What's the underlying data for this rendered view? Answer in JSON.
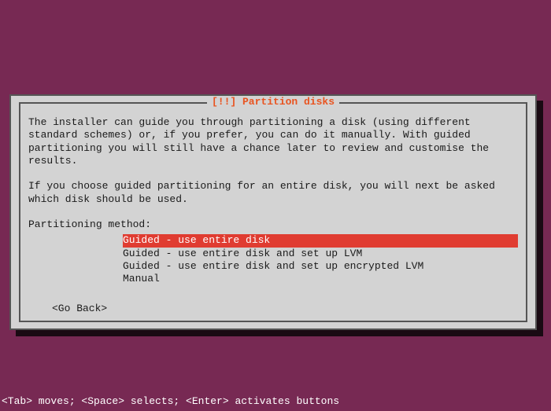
{
  "dialog": {
    "title": "[!!] Partition disks",
    "paragraph1": "The installer can guide you through partitioning a disk (using different standard schemes) or, if you prefer, you can do it manually. With guided partitioning you will still have a chance later to review and customise the results.",
    "paragraph2": "If you choose guided partitioning for an entire disk, you will next be asked which disk should be used.",
    "prompt": "Partitioning method:",
    "options": [
      "Guided - use entire disk",
      "Guided - use entire disk and set up LVM",
      "Guided - use entire disk and set up encrypted LVM",
      "Manual"
    ],
    "selected_index": 0,
    "go_back": "<Go Back>"
  },
  "footer": {
    "help": "<Tab> moves; <Space> selects; <Enter> activates buttons"
  }
}
